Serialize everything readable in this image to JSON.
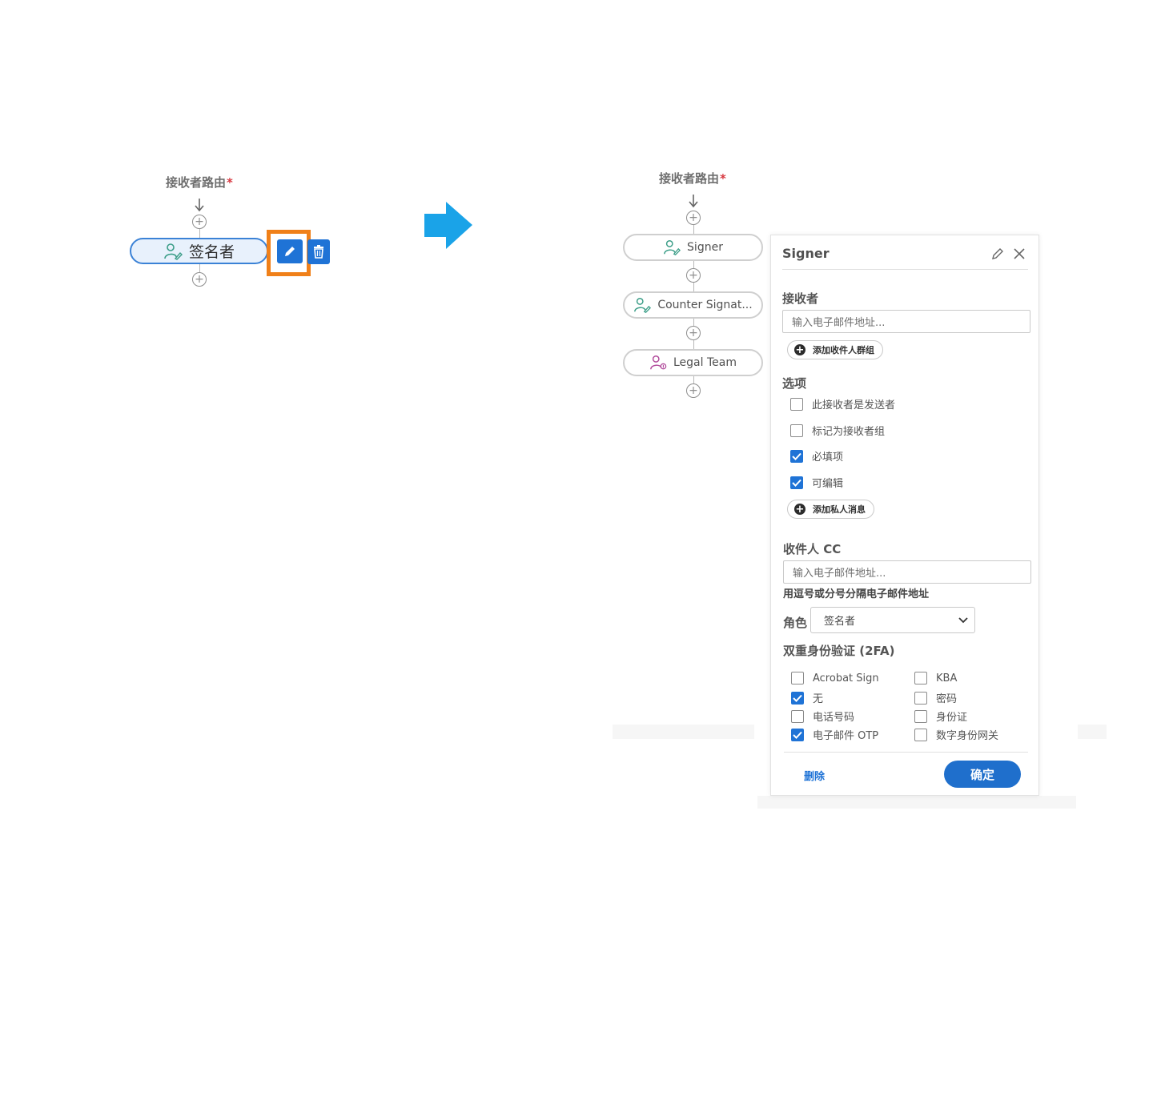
{
  "left_flow": {
    "title": "接收者路由",
    "required_mark": "*",
    "recipient_label": "签名者"
  },
  "right_flow": {
    "title": "接收者路由",
    "required_mark": "*",
    "recipients": [
      {
        "label": "Signer",
        "icon": "signer-icon",
        "color": "#3a9d87"
      },
      {
        "label": "Counter Signat...",
        "icon": "signer-icon",
        "color": "#3a9d87"
      },
      {
        "label": "Legal Team",
        "icon": "group-icon",
        "color": "#b14a9b"
      }
    ]
  },
  "panel": {
    "title": "Signer",
    "recipient_section": {
      "label": "接收者",
      "email_placeholder": "输入电子邮件地址...",
      "add_group_label": "添加收件人群组"
    },
    "options_section": {
      "label": "选项",
      "items": [
        {
          "label": "此接收者是发送者",
          "checked": false
        },
        {
          "label": "标记为接收者组",
          "checked": false
        },
        {
          "label": "必填项",
          "checked": true
        },
        {
          "label": "可编辑",
          "checked": true
        }
      ],
      "add_message_label": "添加私人消息"
    },
    "cc_section": {
      "label": "收件人 CC",
      "email_placeholder": "输入电子邮件地址...",
      "hint": "用逗号或分号分隔电子邮件地址"
    },
    "role": {
      "label": "角色",
      "selected": "签名者"
    },
    "twofa": {
      "label": "双重身份验证 (2FA)",
      "left": [
        {
          "label": "Acrobat Sign",
          "checked": false
        },
        {
          "label": "无",
          "checked": true
        },
        {
          "label": "电话号码",
          "checked": false
        },
        {
          "label": "电子邮件 OTP",
          "checked": true
        }
      ],
      "right": [
        {
          "label": "KBA",
          "checked": false
        },
        {
          "label": "密码",
          "checked": false
        },
        {
          "label": "身份证",
          "checked": false
        },
        {
          "label": "数字身份网关",
          "checked": false
        }
      ]
    },
    "delete_label": "删除",
    "confirm_label": "确定"
  },
  "colors": {
    "accent": "#1f73d6",
    "highlight": "#f08019",
    "arrow": "#1aa3e8"
  }
}
